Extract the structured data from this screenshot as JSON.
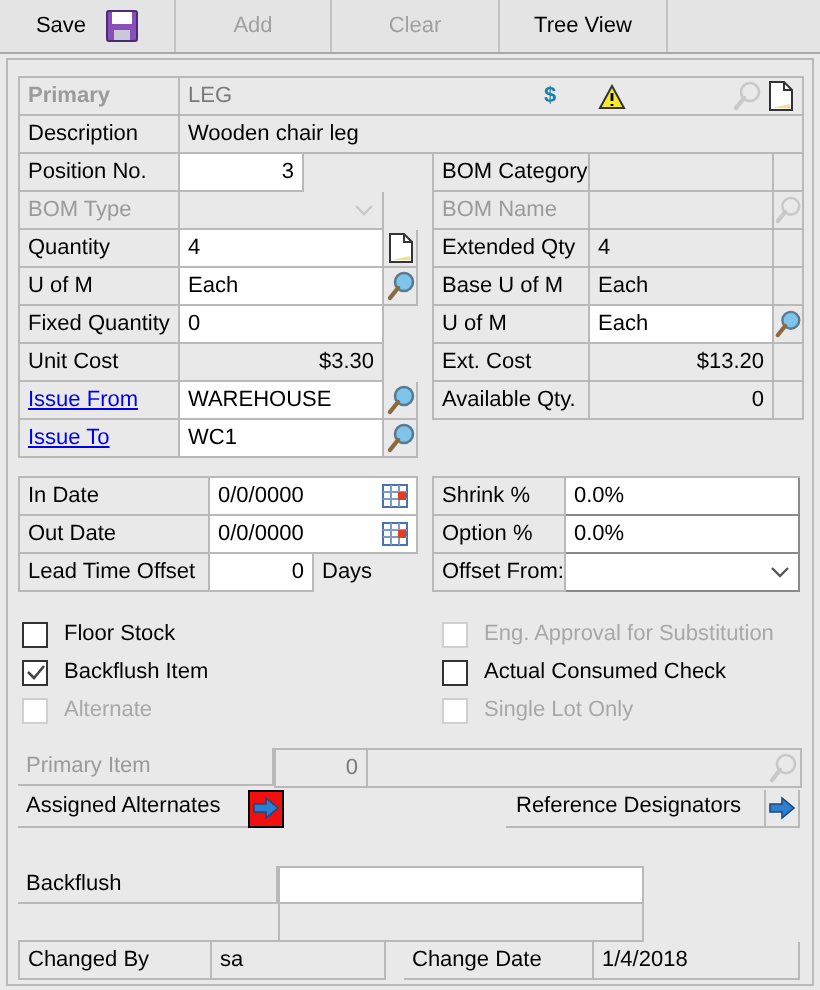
{
  "toolbar": [
    {
      "label": "Save",
      "disabled": false
    },
    {
      "label": "Add",
      "disabled": true
    },
    {
      "label": "Clear",
      "disabled": true
    },
    {
      "label": "Tree View",
      "disabled": false
    }
  ],
  "primary": {
    "label": "Primary",
    "value": "LEG",
    "currency_symbol": "$"
  },
  "description": {
    "label": "Description",
    "value": "Wooden chair leg"
  },
  "left_fields": [
    {
      "label": "Position No.",
      "value": "3",
      "kind": "number",
      "disabled": false
    },
    {
      "label": "BOM Type",
      "kind": "dropdown",
      "disabled": true
    },
    {
      "label": "Quantity",
      "value": "4",
      "kind": "note",
      "disabled": false
    },
    {
      "label": "U of M",
      "value": "Each",
      "kind": "lookup",
      "disabled": false
    },
    {
      "label": "Fixed Quantity",
      "value": "0",
      "kind": "text",
      "disabled": false
    },
    {
      "label": "Unit Cost",
      "value": "$3.30",
      "kind": "amount",
      "disabled": false
    },
    {
      "label": "Issue From",
      "value": "WAREHOUSE",
      "kind": "lookup",
      "link": true,
      "disabled": false
    },
    {
      "label": "Issue To",
      "value": "WC1",
      "kind": "lookup",
      "link": true,
      "disabled": false
    }
  ],
  "right_fields": [
    {
      "label": "BOM Category",
      "kind": "readonly",
      "disabled": false
    },
    {
      "label": "BOM Name",
      "kind": "lookup_readonly",
      "disabled": true
    },
    {
      "label": "Extended Qty",
      "value": "4",
      "kind": "readonly",
      "disabled": false
    },
    {
      "label": "Base U of M",
      "value": "Each",
      "kind": "readonly",
      "disabled": false
    },
    {
      "label": "U of M",
      "value": "Each",
      "kind": "lookup",
      "disabled": false
    },
    {
      "label": "Ext. Cost",
      "value": "$13.20",
      "kind": "amount",
      "disabled": false
    },
    {
      "label": "Available Qty.",
      "value": "0",
      "kind": "amount",
      "disabled": false
    }
  ],
  "date_fields": [
    {
      "label": "In Date",
      "value": "0/0/0000",
      "kind": "date"
    },
    {
      "label": "Out Date",
      "value": "0/0/0000",
      "kind": "date"
    },
    {
      "label": "Lead Time Offset",
      "value": "0",
      "kind": "number",
      "suffix": "Days"
    }
  ],
  "percent_fields": [
    {
      "label": "Shrink %",
      "value": "0.0%",
      "kind": "text"
    },
    {
      "label": "Option %",
      "value": "0.0%",
      "kind": "text"
    },
    {
      "label": "Offset From:",
      "kind": "dropdown"
    }
  ],
  "checkboxes_left": [
    {
      "label": "Floor Stock",
      "checked": false,
      "disabled": false
    },
    {
      "label": "Backflush Item",
      "checked": true,
      "disabled": false
    },
    {
      "label": "Alternate",
      "checked": false,
      "disabled": true
    }
  ],
  "checkboxes_right": [
    {
      "label": "Eng. Approval for Substitution",
      "checked": false,
      "disabled": true
    },
    {
      "label": "Actual Consumed Check",
      "checked": false,
      "disabled": false
    },
    {
      "label": "Single Lot Only",
      "checked": false,
      "disabled": true
    }
  ],
  "primary_item": {
    "label": "Primary Item",
    "value": "0",
    "disabled": true
  },
  "assigned_alternates": {
    "label": "Assigned Alternates",
    "highlighted": true
  },
  "reference_designators": {
    "label": "Reference Designators",
    "highlighted": false
  },
  "backflush": {
    "label": "Backflush"
  },
  "footer": [
    {
      "label": "Changed By",
      "value": "sa"
    },
    {
      "label": "Change Date",
      "value": "1/4/2018"
    }
  ]
}
